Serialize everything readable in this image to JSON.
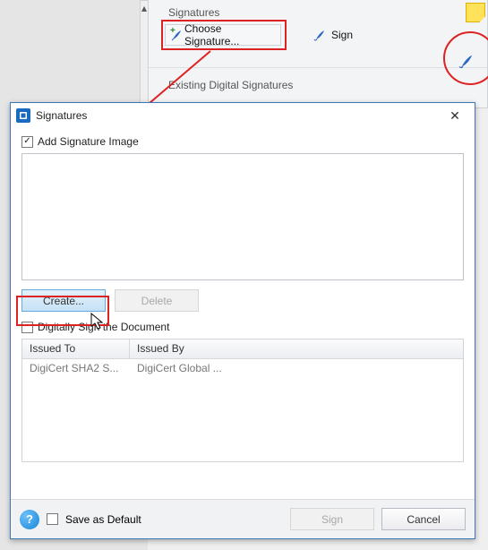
{
  "ribbon": {
    "group_label": "Signatures",
    "choose_label": "Choose Signature...",
    "sign_label": "Sign",
    "existing_label": "Existing Digital Signatures"
  },
  "dialog": {
    "title": "Signatures",
    "add_image_label": "Add Signature Image",
    "add_image_checked": true,
    "create_label": "Create...",
    "delete_label": "Delete",
    "digitally_sign_label": "Digitally Sign the Document",
    "digitally_sign_checked": false,
    "table": {
      "headers": {
        "issued_to": "Issued To",
        "issued_by": "Issued By"
      },
      "rows": [
        {
          "issued_to": "DigiCert SHA2 S...",
          "issued_by": "DigiCert Global ..."
        }
      ]
    },
    "save_default_label": "Save as Default",
    "save_default_checked": false,
    "sign_btn": "Sign",
    "cancel_btn": "Cancel"
  }
}
